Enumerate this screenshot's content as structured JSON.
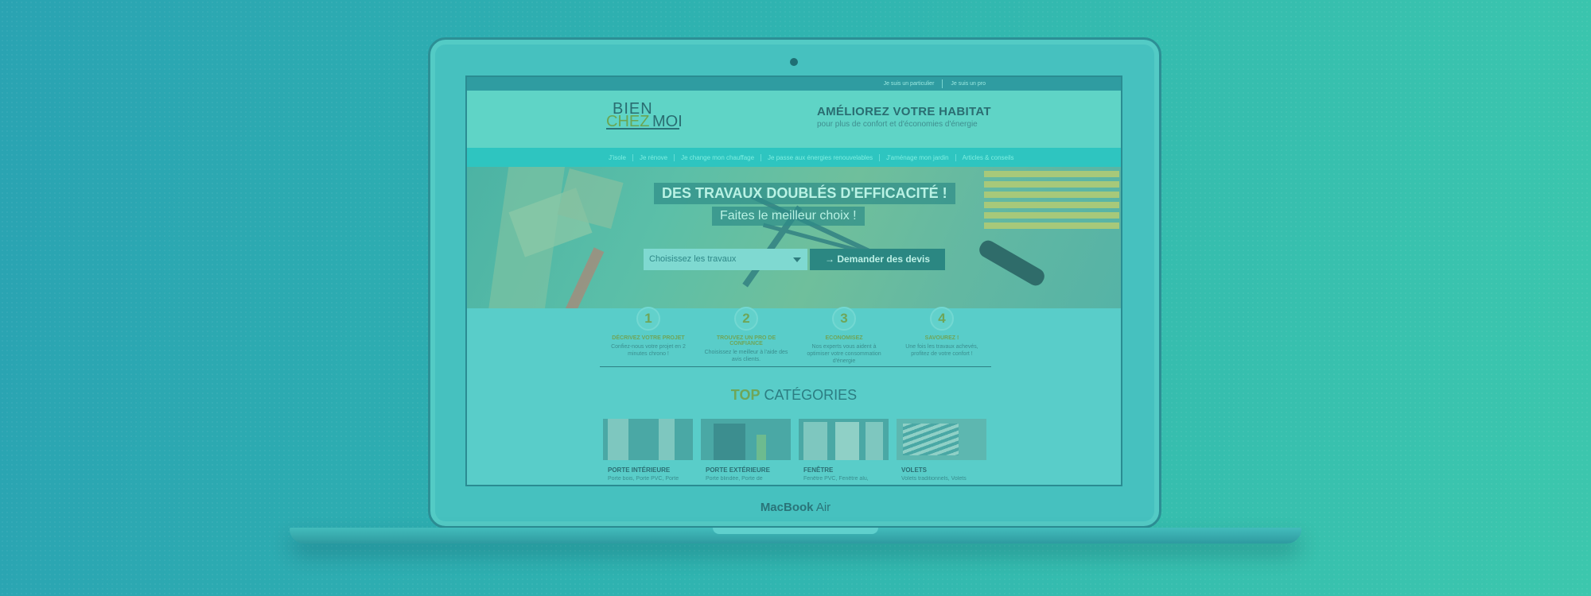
{
  "device": {
    "brand": "MacBook",
    "model": "Air"
  },
  "topbar": {
    "links": [
      "Je suis un particulier",
      "Je suis un pro"
    ]
  },
  "logo": {
    "line1": "BIEN",
    "line2a": "CHEZ",
    "line2b": "MOI"
  },
  "tagline": {
    "title": "AMÉLIOREZ VOTRE HABITAT",
    "subtitle": "pour plus de confort et d'économies d'énergie"
  },
  "nav": {
    "items": [
      "J'isole",
      "Je rénove",
      "Je change mon chauffage",
      "Je passe aux énergies renouvelables",
      "J'aménage mon jardin",
      "Articles & conseils"
    ]
  },
  "hero": {
    "title": "DES TRAVAUX DOUBLÉS D'EFFICACITÉ !",
    "subtitle": "Faites le meilleur choix !",
    "select_value": "Choisissez les travaux",
    "cta_label": "Demander des devis"
  },
  "steps": [
    {
      "num": "1",
      "title": "DÉCRIVEZ VOTRE PROJET",
      "desc": "Confiez-nous votre projet en 2 minutes chrono !"
    },
    {
      "num": "2",
      "title": "TROUVEZ UN PRO DE CONFIANCE",
      "desc": "Choisissez le meilleur à l'aide des avis clients."
    },
    {
      "num": "3",
      "title": "ECONOMISEZ",
      "desc": "Nos experts vous aident à optimiser votre consommation d'énergie"
    },
    {
      "num": "4",
      "title": "SAVOUREZ !",
      "desc": "Une fois les travaux achevés, profitez de votre confort !"
    }
  ],
  "categories_title": {
    "highlight": "TOP",
    "rest": "CATÉGORIES"
  },
  "categories": [
    {
      "name": "PORTE INTÉRIEURE",
      "desc": "Porte bois, Porte PVC, Porte"
    },
    {
      "name": "PORTE EXTÉRIEURE",
      "desc": "Porte blindée, Porte de"
    },
    {
      "name": "FENÊTRE",
      "desc": "Fenêtre PVC, Fenêtre alu,"
    },
    {
      "name": "VOLETS",
      "desc": "Volets traditionnels, Volets"
    }
  ]
}
